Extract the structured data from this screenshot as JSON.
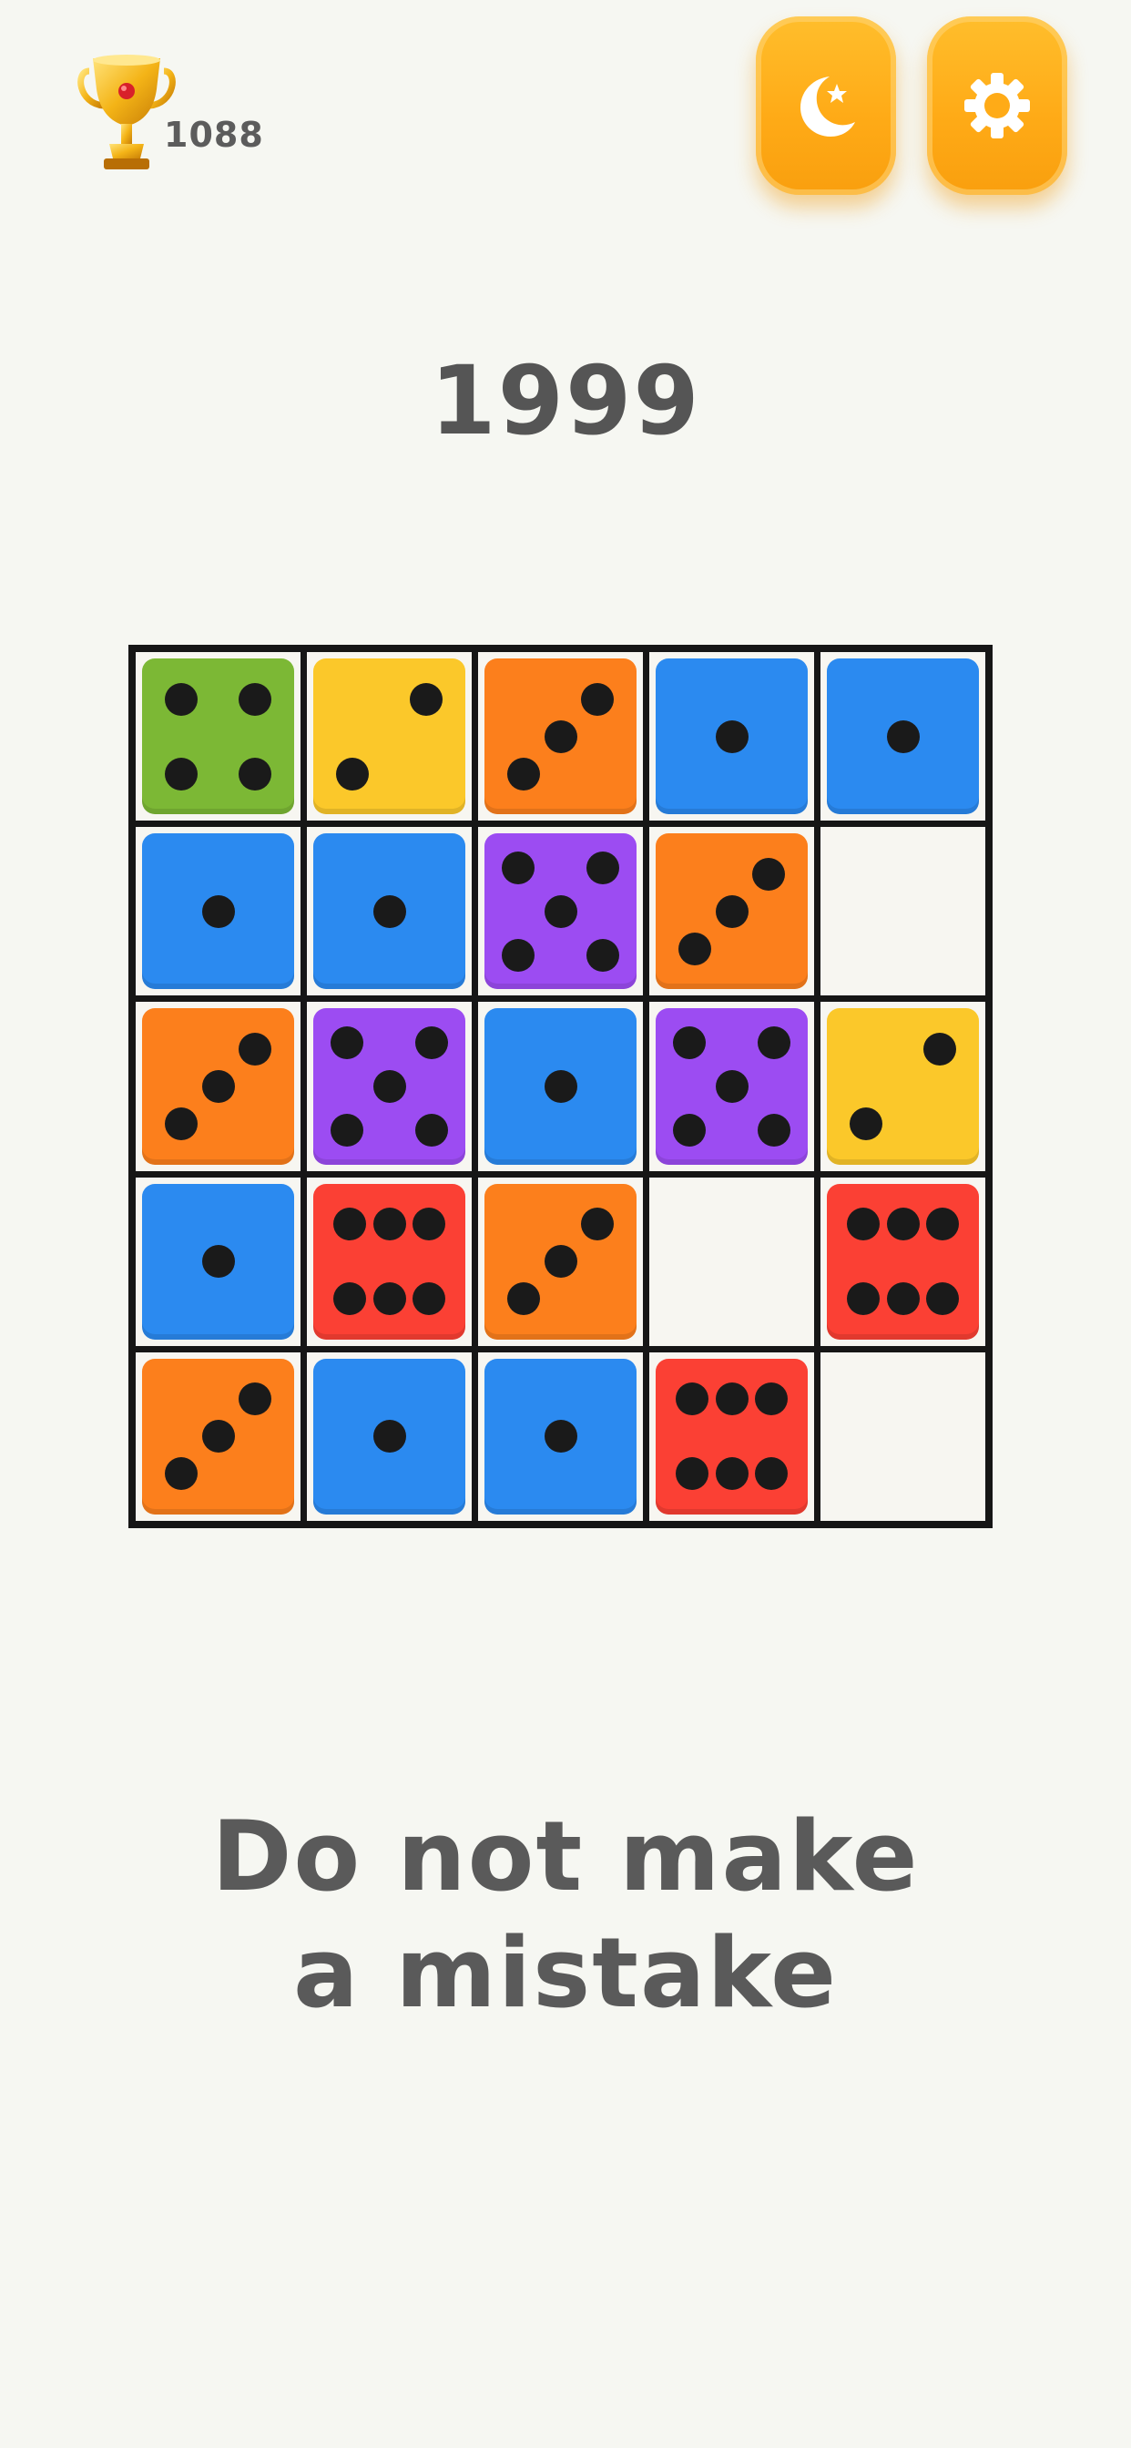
{
  "header": {
    "best_score": "1088",
    "icons": {
      "trophy": "trophy-icon",
      "theme": "moon-star-icon",
      "settings": "gear-icon"
    },
    "accent_color": "#ffab17"
  },
  "score": "1999",
  "board": {
    "rows": 5,
    "cols": 5,
    "cells": [
      [
        4,
        2,
        3,
        1,
        1
      ],
      [
        1,
        1,
        5,
        3,
        0
      ],
      [
        3,
        5,
        1,
        5,
        2
      ],
      [
        1,
        6,
        3,
        0,
        6
      ],
      [
        3,
        1,
        1,
        6,
        0
      ]
    ],
    "colors": {
      "1": "#2b8af0",
      "2": "#fbc82a",
      "3": "#fc7f1c",
      "4": "#7cb835",
      "5": "#9c4cf2",
      "6": "#fb4034"
    },
    "empty_color": "#f7f6f1"
  },
  "message": {
    "line1": "Do not make",
    "line2": "a mistake"
  }
}
